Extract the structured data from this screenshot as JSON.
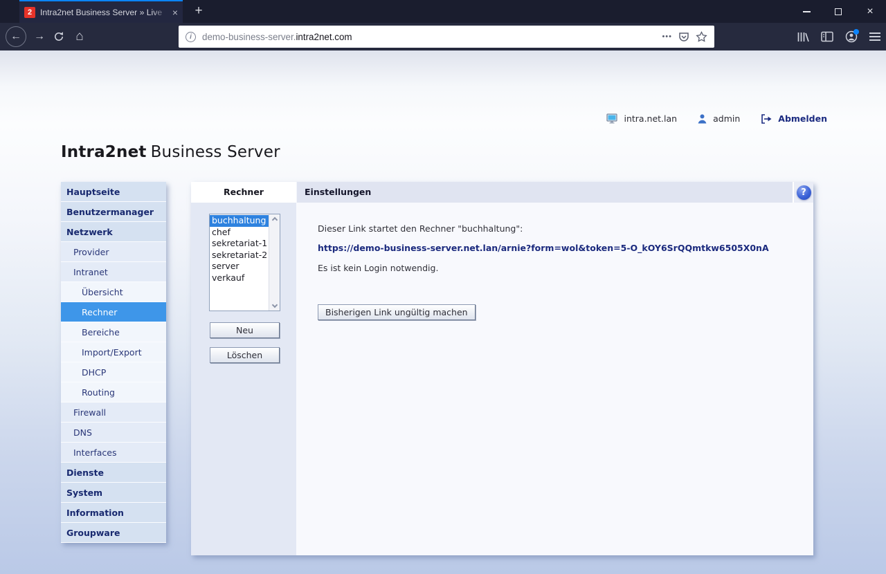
{
  "browser": {
    "tab_title": "Intra2net Business Server » Live",
    "url_prefix": "demo-business-server.",
    "url_domain": "intra2net.com"
  },
  "icons": {
    "favicon_2": "2",
    "plus": "+",
    "close_x": "×",
    "back_arrow": "←",
    "forward_arrow": "→",
    "home": "⌂",
    "info_i": "i",
    "ellipsis": "•••",
    "question": "?"
  },
  "header": {
    "host": "intra.net.lan",
    "user": "admin",
    "logout_label": "Abmelden",
    "brand_bold": "Intra2net",
    "brand_rest": "Business Server"
  },
  "sidebar": {
    "items": [
      {
        "label": "Hauptseite",
        "level": 0
      },
      {
        "label": "Benutzermanager",
        "level": 0
      },
      {
        "label": "Netzwerk",
        "level": 0
      },
      {
        "label": "Provider",
        "level": 1
      },
      {
        "label": "Intranet",
        "level": 1
      },
      {
        "label": "Übersicht",
        "level": 2
      },
      {
        "label": "Rechner",
        "level": 2,
        "selected": true
      },
      {
        "label": "Bereiche",
        "level": 2
      },
      {
        "label": "Import/Export",
        "level": 2
      },
      {
        "label": "DHCP",
        "level": 2
      },
      {
        "label": "Routing",
        "level": 2
      },
      {
        "label": "Firewall",
        "level": 1
      },
      {
        "label": "DNS",
        "level": 1
      },
      {
        "label": "Interfaces",
        "level": 1
      },
      {
        "label": "Dienste",
        "level": 0
      },
      {
        "label": "System",
        "level": 0
      },
      {
        "label": "Information",
        "level": 0
      },
      {
        "label": "Groupware",
        "level": 0
      }
    ]
  },
  "main": {
    "tab_label": "Rechner",
    "panel_title": "Einstellungen",
    "computer_list": {
      "items": [
        "buchhaltung",
        "chef",
        "sekretariat-1",
        "sekretariat-2",
        "server",
        "verkauf"
      ],
      "selected": "buchhaltung"
    },
    "buttons": {
      "new": "Neu",
      "delete": "Löschen",
      "invalidate": "Bisherigen Link ungültig machen"
    },
    "settings": {
      "intro": "Dieser Link startet den Rechner \"buchhaltung\":",
      "link": "https://demo-business-server.net.lan/arnie?form=wol&token=5-O_kOY6SrQQmtkw6505X0nA",
      "note": "Es ist kein Login notwendig."
    }
  }
}
